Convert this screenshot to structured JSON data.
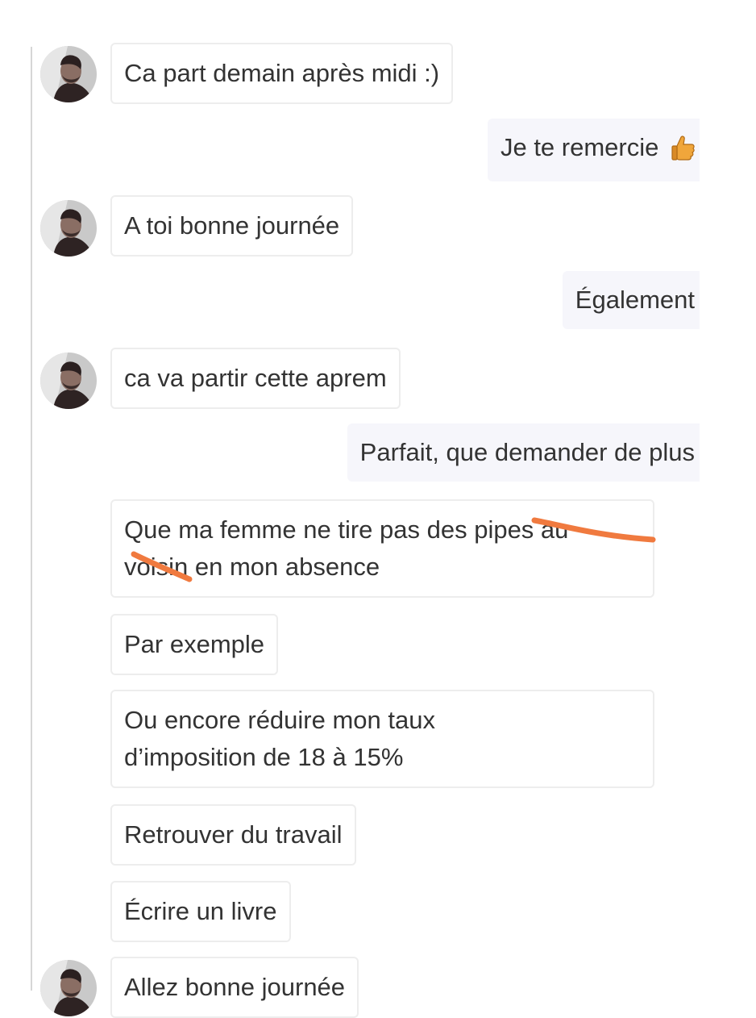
{
  "conversation": {
    "messages": [
      {
        "direction": "incoming",
        "has_avatar": true,
        "text": "Ca part demain après midi :)"
      },
      {
        "direction": "outgoing",
        "text": "Je te remercie",
        "emoji_icon": "thumbs-up-icon"
      },
      {
        "direction": "incoming",
        "has_avatar": true,
        "text": "A toi bonne journée"
      },
      {
        "direction": "outgoing",
        "text": "Également"
      },
      {
        "direction": "incoming",
        "has_avatar": true,
        "text": "ca va partir cette aprem"
      },
      {
        "direction": "outgoing",
        "text": "Parfait, que demander de plus"
      },
      {
        "direction": "incoming",
        "has_avatar": false,
        "lines": [
          "Que ma femme ne tire pas des pipes au",
          "voisin en mon absence"
        ],
        "redaction_marks": 2
      },
      {
        "direction": "incoming",
        "has_avatar": false,
        "text": "Par exemple"
      },
      {
        "direction": "incoming",
        "has_avatar": false,
        "lines": [
          "Ou encore réduire mon taux",
          "d’imposition de 18 à 15%"
        ]
      },
      {
        "direction": "incoming",
        "has_avatar": false,
        "text": "Retrouver du travail"
      },
      {
        "direction": "incoming",
        "has_avatar": false,
        "text": "Écrire un livre"
      },
      {
        "direction": "incoming",
        "has_avatar": true,
        "text": "Allez bonne journée"
      }
    ]
  },
  "colors": {
    "incoming_bubble_bg": "#ffffff",
    "incoming_bubble_border": "#ededed",
    "outgoing_bubble_bg": "#f6f6fb",
    "text": "#333333",
    "redaction_mark": "#f07a3f",
    "thread_rule": "#d6d6d6"
  }
}
